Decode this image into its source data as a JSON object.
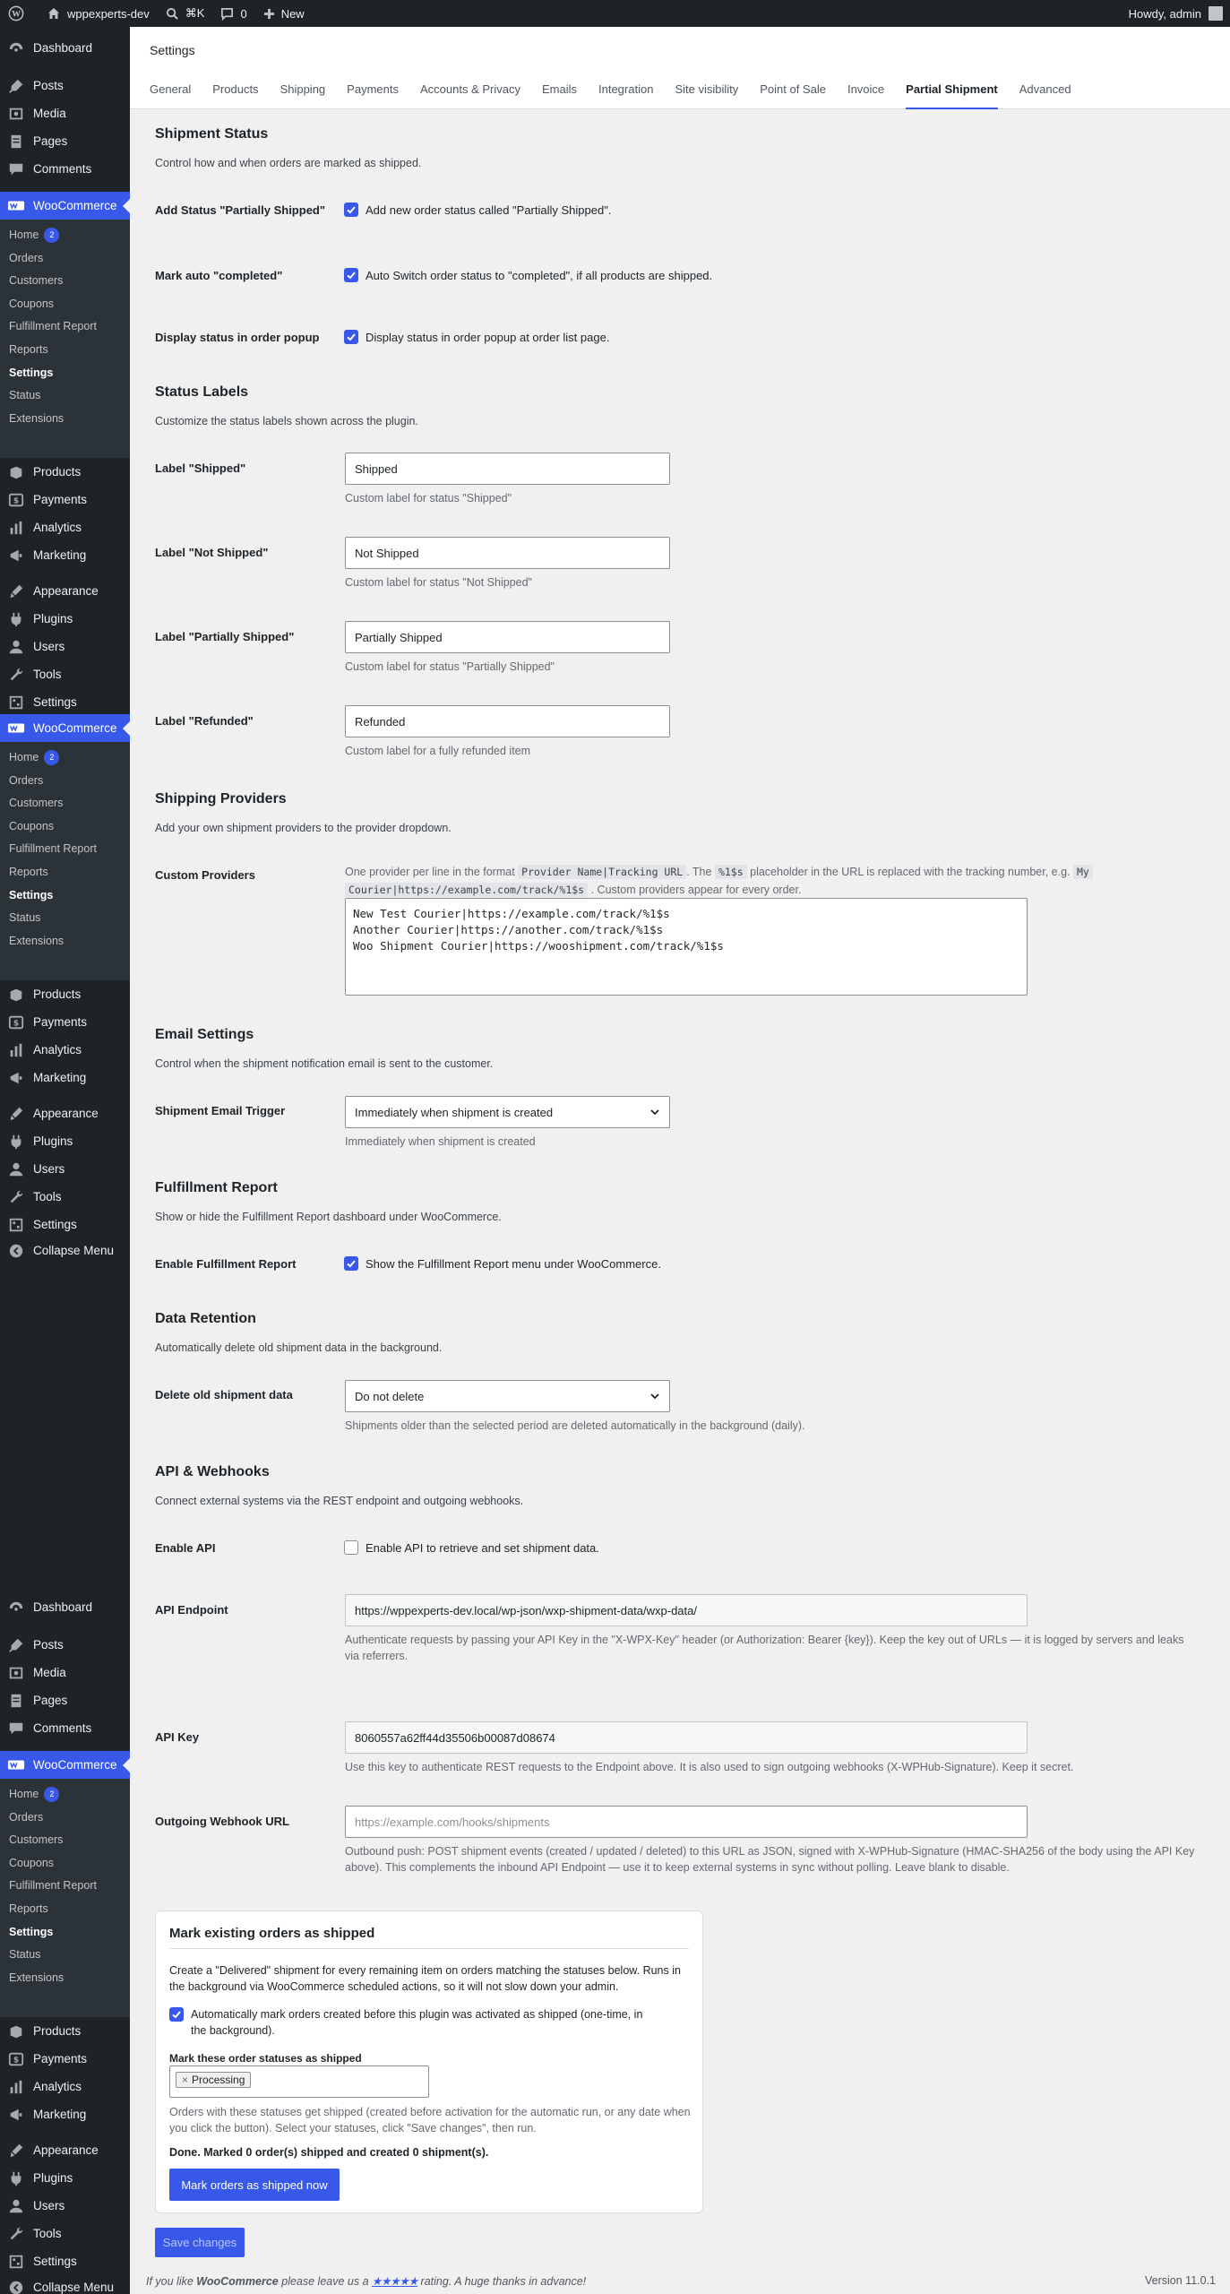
{
  "adminbar": {
    "site_name": "wppexperts-dev",
    "shortcut": "⌘K",
    "comments_count": "0",
    "new_label": "New",
    "howdy": "Howdy, admin"
  },
  "sidebar": {
    "dashboard": "Dashboard",
    "posts": "Posts",
    "media": "Media",
    "pages": "Pages",
    "comments": "Comments",
    "woocommerce": "WooCommerce",
    "wc_sub": {
      "home": "Home",
      "home_badge": "2",
      "orders": "Orders",
      "customers": "Customers",
      "coupons": "Coupons",
      "fulfillment_report": "Fulfillment Report",
      "reports": "Reports",
      "settings": "Settings",
      "status": "Status",
      "extensions": "Extensions"
    },
    "products": "Products",
    "payments": "Payments",
    "analytics": "Analytics",
    "marketing": "Marketing",
    "appearance": "Appearance",
    "plugins": "Plugins",
    "users": "Users",
    "tools": "Tools",
    "settings": "Settings",
    "collapse": "Collapse Menu"
  },
  "header": {
    "title": "Settings",
    "tabs": [
      "General",
      "Products",
      "Shipping",
      "Payments",
      "Accounts & Privacy",
      "Emails",
      "Integration",
      "Site visibility",
      "Point of Sale",
      "Invoice",
      "Partial Shipment",
      "Advanced"
    ],
    "active_tab": "Partial Shipment"
  },
  "shipment_status": {
    "title": "Shipment Status",
    "desc": "Control how and when orders are marked as shipped.",
    "add_status_label": "Add Status \"Partially Shipped\"",
    "add_status_text": "Add new order status called \"Partially Shipped\".",
    "mark_auto_label": "Mark auto \"completed\"",
    "mark_auto_text": "Auto Switch order status to \"completed\", if all products are shipped.",
    "display_popup_label": "Display status in order popup",
    "display_popup_text": "Display status in order popup at order list page."
  },
  "status_labels": {
    "title": "Status Labels",
    "desc": "Customize the status labels shown across the plugin.",
    "shipped_label": "Label \"Shipped\"",
    "shipped_value": "Shipped",
    "shipped_help": "Custom label for status \"Shipped\"",
    "not_shipped_label": "Label \"Not Shipped\"",
    "not_shipped_value": "Not Shipped",
    "not_shipped_help": "Custom label for status \"Not Shipped\"",
    "partial_label": "Label \"Partially Shipped\"",
    "partial_value": "Partially Shipped",
    "partial_help": "Custom label for status \"Partially Shipped\"",
    "refunded_label": "Label \"Refunded\"",
    "refunded_value": "Refunded",
    "refunded_help": "Custom label for a fully refunded item"
  },
  "shipping_providers": {
    "title": "Shipping Providers",
    "desc": "Add your own shipment providers to the provider dropdown.",
    "custom_label": "Custom Providers",
    "help_1": "One provider per line in the format",
    "help_code_1": "Provider Name|Tracking URL",
    "help_2": ". The",
    "help_code_2": "%1$s",
    "help_3": "placeholder in the URL is replaced with the tracking number, e.g.",
    "help_code_3a": "My",
    "help_code_3b": "Courier|https://example.com/track/%1$s",
    "help_4": ". Custom providers appear for every order.",
    "providers": "New Test Courier|https://example.com/track/%1$s\nAnother Courier|https://another.com/track/%1$s\nWoo Shipment Courier|https://wooshipment.com/track/%1$s"
  },
  "email_settings": {
    "title": "Email Settings",
    "desc": "Control when the shipment notification email is sent to the customer.",
    "trigger_label": "Shipment Email Trigger",
    "trigger_value": "Immediately when shipment is created",
    "trigger_help": "Immediately when shipment is created"
  },
  "fulfillment_report": {
    "title": "Fulfillment Report",
    "desc": "Show or hide the Fulfillment Report dashboard under WooCommerce.",
    "enable_label": "Enable Fulfillment Report",
    "enable_text": "Show the Fulfillment Report menu under WooCommerce."
  },
  "data_retention": {
    "title": "Data Retention",
    "desc": "Automatically delete old shipment data in the background.",
    "delete_label": "Delete old shipment data",
    "delete_value": "Do not delete",
    "delete_help": "Shipments older than the selected period are deleted automatically in the background (daily)."
  },
  "api": {
    "title": "API & Webhooks",
    "desc": "Connect external systems via the REST endpoint and outgoing webhooks.",
    "enable_label": "Enable API",
    "enable_text": "Enable API to retrieve and set shipment data.",
    "endpoint_label": "API Endpoint",
    "endpoint_value": "https://wppexperts-dev.local/wp-json/wxp-shipment-data/wxp-data/",
    "endpoint_help": "Authenticate requests by passing your API Key in the \"X-WPX-Key\" header (or Authorization: Bearer {key}). Keep the key out of URLs — it is logged by servers and leaks via referrers.",
    "key_label": "API Key",
    "key_value": "8060557a62ff44d35506b00087d08674",
    "key_help": "Use this key to authenticate REST requests to the Endpoint above. It is also used to sign outgoing webhooks (X-WPHub-Signature). Keep it secret.",
    "webhook_label": "Outgoing Webhook URL",
    "webhook_placeholder": "https://example.com/hooks/shipments",
    "webhook_help": "Outbound push: POST shipment events (created / updated / deleted) to this URL as JSON, signed with X-WPHub-Signature (HMAC-SHA256 of the body using the API Key above). This complements the inbound API Endpoint — use it to keep external systems in sync without polling. Leave blank to disable."
  },
  "mark_existing": {
    "title": "Mark existing orders as shipped",
    "desc": "Create a \"Delivered\" shipment for every remaining item on orders matching the statuses below. Runs in the background via WooCommerce scheduled actions, so it will not slow down your admin.",
    "auto_text": "Automatically mark orders created before this plugin was activated as shipped (one-time, in the background).",
    "statuses_label": "Mark these order statuses as shipped",
    "chip": "Processing",
    "statuses_help": "Orders with these statuses get shipped (created before activation for the automatic run, or any date when you click the button). Select your statuses, click \"Save changes\", then run.",
    "done_text": "Done. Marked 0 order(s) shipped and created 0 shipment(s).",
    "button": "Mark orders as shipped now"
  },
  "save_button": "Save changes",
  "footer": {
    "text_1": "If you like",
    "brand": "WooCommerce",
    "text_2": "please leave us a",
    "stars": "★★★★★",
    "text_3": "rating. A huge thanks in advance!",
    "version": "Version 11.0.1"
  }
}
